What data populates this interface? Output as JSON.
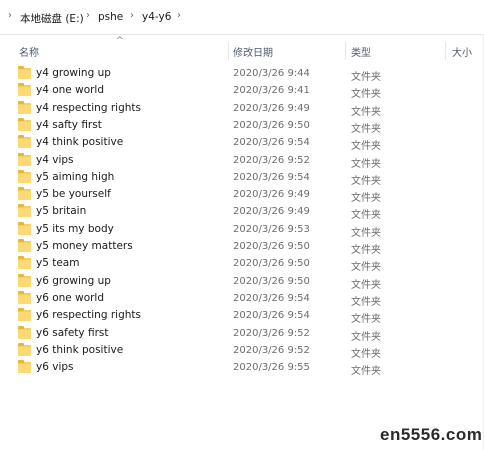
{
  "breadcrumb": {
    "items": [
      "本地磁盘 (E:)",
      "pshe",
      "y4-y6"
    ]
  },
  "columns": {
    "name": "名称",
    "date": "修改日期",
    "type": "类型",
    "size": "大小"
  },
  "files": [
    {
      "name": "y4 growing up",
      "date": "2020/3/26 9:44",
      "type": "文件夹"
    },
    {
      "name": "y4 one world",
      "date": "2020/3/26 9:41",
      "type": "文件夹"
    },
    {
      "name": "y4 respecting rights",
      "date": "2020/3/26 9:49",
      "type": "文件夹"
    },
    {
      "name": "y4 safty first",
      "date": "2020/3/26 9:50",
      "type": "文件夹"
    },
    {
      "name": "y4 think positive",
      "date": "2020/3/26 9:54",
      "type": "文件夹"
    },
    {
      "name": "y4 vips",
      "date": "2020/3/26 9:52",
      "type": "文件夹"
    },
    {
      "name": "y5 aiming high",
      "date": "2020/3/26 9:54",
      "type": "文件夹"
    },
    {
      "name": "y5 be yourself",
      "date": "2020/3/26 9:49",
      "type": "文件夹"
    },
    {
      "name": "y5 britain",
      "date": "2020/3/26 9:49",
      "type": "文件夹"
    },
    {
      "name": "y5 its my body",
      "date": "2020/3/26 9:53",
      "type": "文件夹"
    },
    {
      "name": "y5 money matters",
      "date": "2020/3/26 9:50",
      "type": "文件夹"
    },
    {
      "name": "y5 team",
      "date": "2020/3/26 9:50",
      "type": "文件夹"
    },
    {
      "name": "y6 growing up",
      "date": "2020/3/26 9:50",
      "type": "文件夹"
    },
    {
      "name": "y6 one world",
      "date": "2020/3/26 9:54",
      "type": "文件夹"
    },
    {
      "name": "y6 respecting rights",
      "date": "2020/3/26 9:54",
      "type": "文件夹"
    },
    {
      "name": "y6 safety first",
      "date": "2020/3/26 9:52",
      "type": "文件夹"
    },
    {
      "name": "y6 think positive",
      "date": "2020/3/26 9:52",
      "type": "文件夹"
    },
    {
      "name": "y6 vips",
      "date": "2020/3/26 9:55",
      "type": "文件夹"
    }
  ],
  "watermark": "en5556.com",
  "icons": {
    "chevron": "chevron-right-icon",
    "folder": "folder-icon",
    "sort": "sort-up-icon"
  },
  "colors": {
    "folder": "#fcd975",
    "header_text": "#4d5a6b",
    "meta_text": "#6d6d6d"
  }
}
